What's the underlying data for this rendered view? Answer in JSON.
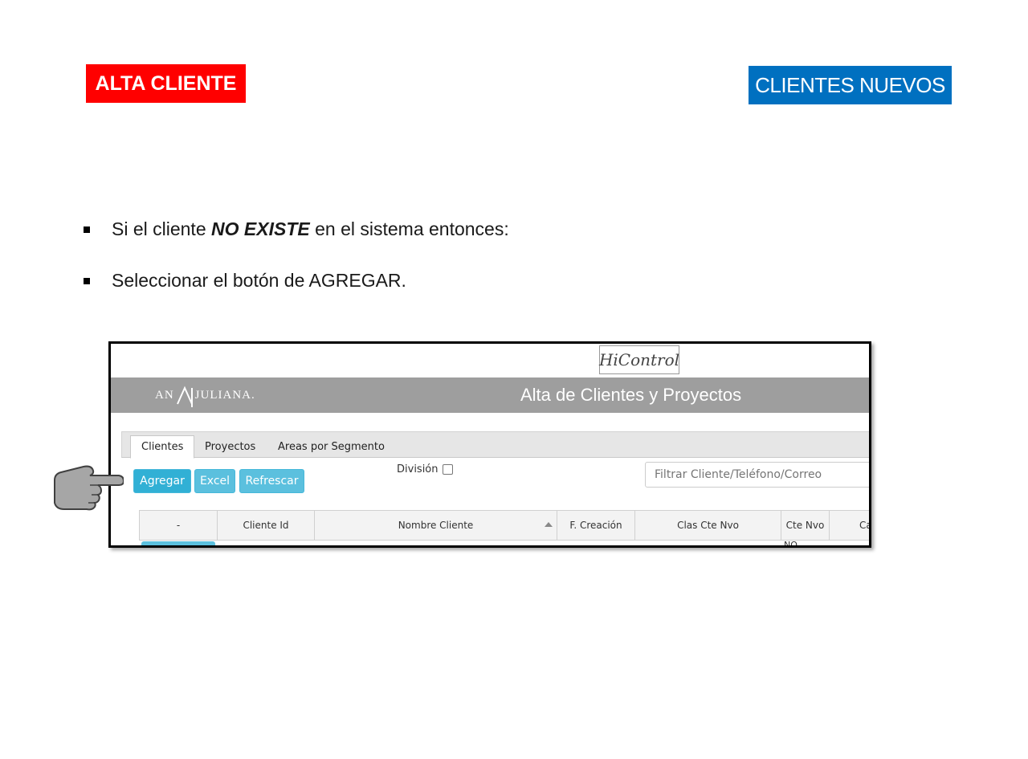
{
  "slide": {
    "tag_left": "ALTA CLIENTE",
    "tag_right": "CLIENTES NUEVOS",
    "bullets": [
      {
        "before": "Si el cliente ",
        "emph": "NO EXISTE",
        "after": " en el sistema entonces:"
      },
      {
        "text": "Seleccionar el botón de AGREGAR."
      }
    ],
    "colors": {
      "tag_left": "#ff0000",
      "tag_right": "#0070c0"
    }
  },
  "screenshot": {
    "app_logo_text": "HiControl",
    "brand_left": "AN",
    "brand_right": "JULIANA.",
    "page_title": "Alta de Clientes y Proyectos",
    "tabs": [
      {
        "label": "Clientes",
        "active": true
      },
      {
        "label": "Proyectos",
        "active": false
      },
      {
        "label": "Areas por Segmento",
        "active": false
      }
    ],
    "buttons": {
      "add": "Agregar",
      "excel": "Excel",
      "refresh": "Refrescar"
    },
    "division_label": "División",
    "division_checked": false,
    "filter_placeholder": "Filtrar Cliente/Teléfono/Correo",
    "grid_columns": [
      "-",
      "Cliente Id",
      "Nombre Cliente",
      "F. Creación",
      "Clas Cte Nvo",
      "Cte Nvo",
      "Ca"
    ],
    "row_peek_text": "NO",
    "colors": {
      "banner": "#9e9e9e",
      "button": "#5bc0de"
    }
  },
  "pointer": {
    "icon": "pointing-hand-icon"
  }
}
